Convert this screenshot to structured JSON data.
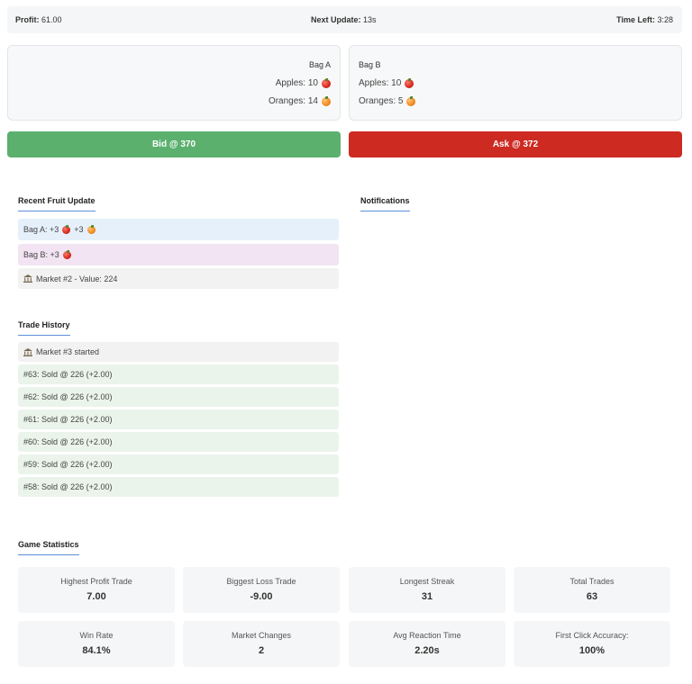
{
  "topbar": {
    "profit_label": "Profit:",
    "profit_value": "61.00",
    "next_update_label": "Next Update:",
    "next_update_value": "13s",
    "time_left_label": "Time Left:",
    "time_left_value": "3:28"
  },
  "bag_a": {
    "title": "Bag A",
    "apples": "Apples: 10",
    "oranges": "Oranges: 14",
    "apple_icon": "apple-icon",
    "orange_icon": "orange-icon"
  },
  "bag_b": {
    "title": "Bag B",
    "apples": "Apples: 10",
    "oranges": "Oranges: 5",
    "apple_icon": "apple-icon",
    "orange_icon": "orange-icon"
  },
  "actions": {
    "bid": "Bid @ 370",
    "ask": "Ask @ 372",
    "bid_color": "#5bb06e",
    "ask_color": "#cd2a22"
  },
  "recent_update": {
    "heading": "Recent Fruit Update",
    "items": [
      {
        "part1": "Bag A: +3",
        "part2": "+3"
      },
      {
        "part1": "Bag B: +3"
      },
      {
        "part1": "Market #2 - Value: 224"
      }
    ]
  },
  "notifications": {
    "heading": "Notifications"
  },
  "trade_history": {
    "heading": "Trade History",
    "items": [
      "Market #3 started",
      "#63: Sold @ 226 (+2.00)",
      "#62: Sold @ 226 (+2.00)",
      "#61: Sold @ 226 (+2.00)",
      "#60: Sold @ 226 (+2.00)",
      "#59: Sold @ 226 (+2.00)",
      "#58: Sold @ 226 (+2.00)"
    ]
  },
  "stats": {
    "heading": "Game Statistics",
    "cards": [
      {
        "label": "Highest Profit Trade",
        "value": "7.00"
      },
      {
        "label": "Biggest Loss Trade",
        "value": "-9.00"
      },
      {
        "label": "Longest Streak",
        "value": "31"
      },
      {
        "label": "Total Trades",
        "value": "63"
      },
      {
        "label": "Win Rate",
        "value": "84.1%"
      },
      {
        "label": "Market Changes",
        "value": "2"
      },
      {
        "label": "Avg Reaction Time",
        "value": "2.20s"
      },
      {
        "label": "First Click Accuracy:",
        "value": "100%"
      }
    ]
  }
}
